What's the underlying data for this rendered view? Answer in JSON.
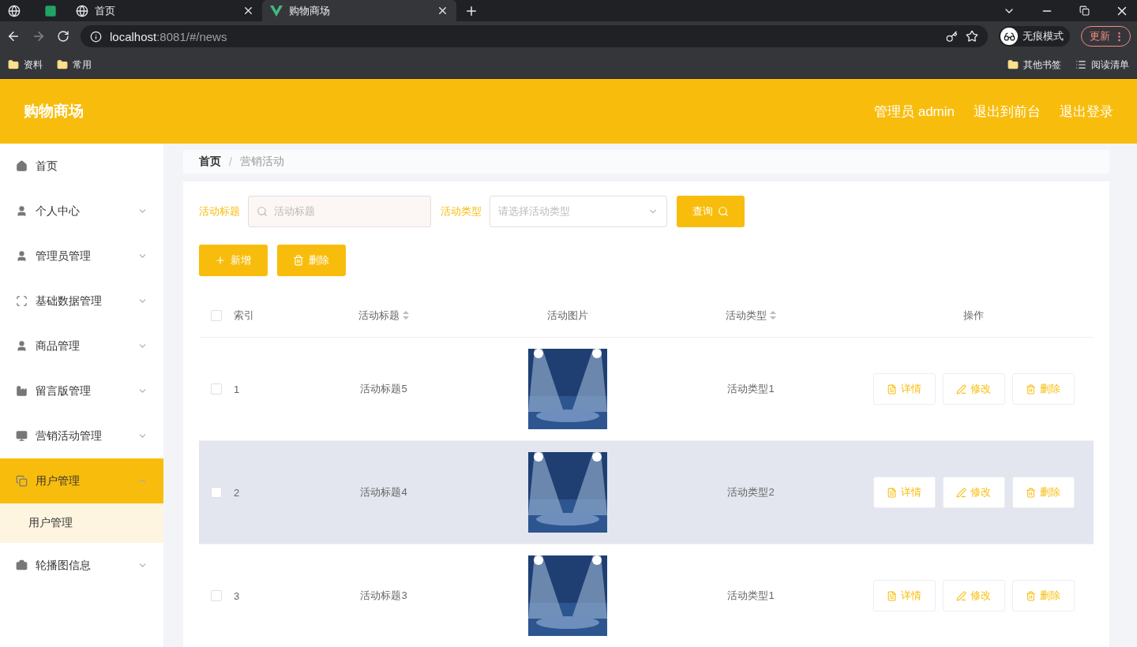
{
  "browser": {
    "tabs": [
      {
        "kind": "pinned-globe",
        "selected": false
      },
      {
        "kind": "pinned-sheet",
        "selected": false
      },
      {
        "kind": "page",
        "title": "首页",
        "selected": false
      },
      {
        "kind": "vue",
        "title": "购物商场",
        "selected": true
      }
    ],
    "url_host": "localhost",
    "url_rest": ":8081/#/news",
    "profile": "无痕模式",
    "update": "更新",
    "bookmarks": [
      "资料",
      "常用"
    ],
    "bookmarks_right": [
      "其他书签",
      "阅读清单"
    ]
  },
  "header": {
    "title": "购物商场",
    "links": [
      "管理员 admin",
      "退出到前台",
      "退出登录"
    ]
  },
  "sidebar": {
    "items": [
      {
        "label": "首页",
        "kind": "link",
        "selected": false
      },
      {
        "label": "个人中心",
        "kind": "submenu",
        "expanded": false,
        "selected": false
      },
      {
        "label": "管理员管理",
        "kind": "submenu",
        "expanded": false,
        "selected": false
      },
      {
        "label": "基础数据管理",
        "kind": "submenu",
        "expanded": false,
        "selected": false
      },
      {
        "label": "商品管理",
        "kind": "submenu",
        "expanded": false,
        "selected": false
      },
      {
        "label": "留言版管理",
        "kind": "submenu",
        "expanded": false,
        "selected": false
      },
      {
        "label": "营销活动管理",
        "kind": "submenu",
        "expanded": false,
        "selected": false
      },
      {
        "label": "用户管理",
        "kind": "submenu",
        "expanded": true,
        "selected": true,
        "children": [
          {
            "label": "用户管理"
          }
        ]
      },
      {
        "label": "轮播图信息",
        "kind": "submenu",
        "expanded": false,
        "selected": false
      }
    ]
  },
  "breadcrumb": [
    "首页",
    "营销活动"
  ],
  "breadcrumb_separator": "/",
  "search": {
    "title_label": "活动标题",
    "title_placeholder": "活动标题",
    "type_label": "活动类型",
    "type_placeholder": "请选择活动类型",
    "button": "查询"
  },
  "actions": [
    "新增",
    "删除"
  ],
  "table": {
    "all_checked": false,
    "columns": [
      {
        "label": "索引",
        "sortable": false
      },
      {
        "label": "活动标题",
        "sortable": true
      },
      {
        "label": "活动图片",
        "sortable": false
      },
      {
        "label": "活动类型",
        "sortable": true
      },
      {
        "label": "操作",
        "sortable": false
      }
    ],
    "rows": [
      {
        "index": "1",
        "title": "活动标题5",
        "image": {
          "kind": "picture"
        },
        "type": "活动类型1",
        "checked": false,
        "highlighted": false,
        "buttons": [
          "详情",
          "修改",
          "删除"
        ]
      },
      {
        "index": "2",
        "title": "活动标题4",
        "image": {
          "kind": "picture"
        },
        "type": "活动类型2",
        "checked": false,
        "highlighted": true,
        "buttons": [
          "详情",
          "修改",
          "删除"
        ]
      },
      {
        "index": "3",
        "title": "活动标题3",
        "image": {
          "kind": "picture"
        },
        "type": "活动类型1",
        "checked": false,
        "highlighted": false,
        "buttons": [
          "详情",
          "修改",
          "删除"
        ]
      }
    ]
  }
}
